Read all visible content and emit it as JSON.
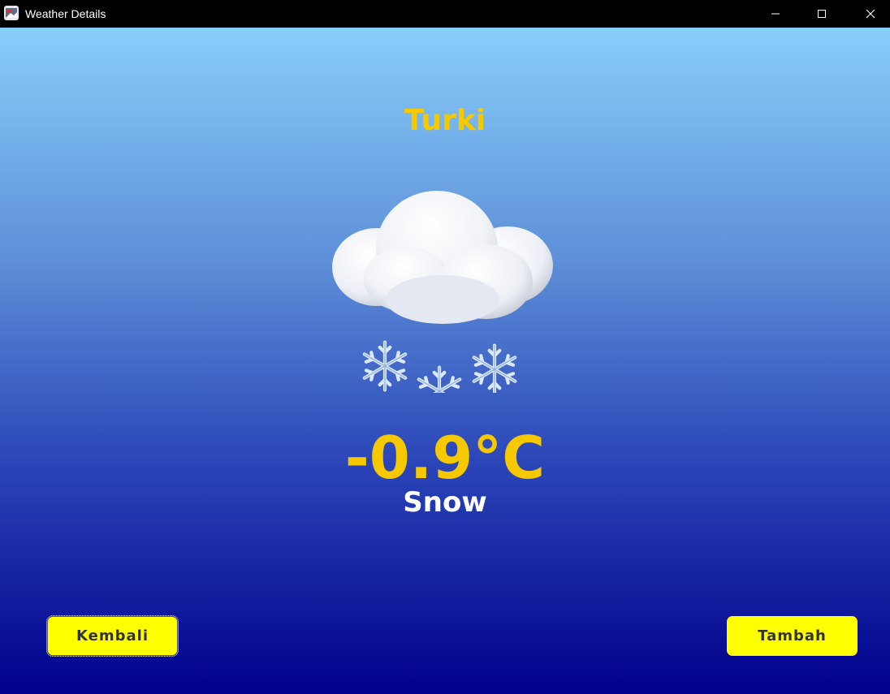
{
  "window": {
    "title": "Weather Details",
    "controls": {
      "minimize": "–",
      "maximize": "□",
      "close": "✕"
    }
  },
  "weather": {
    "city": "Turki",
    "icon": "snow-cloud-icon",
    "temperature": "-0.9°C",
    "condition": "Snow"
  },
  "buttons": {
    "back_label": "Kembali",
    "add_label": "Tambah"
  },
  "colors": {
    "accent_text": "#f5c800",
    "button_bg": "#ffff00",
    "gradient_top": "#87cefa",
    "gradient_bottom": "#00008b"
  }
}
